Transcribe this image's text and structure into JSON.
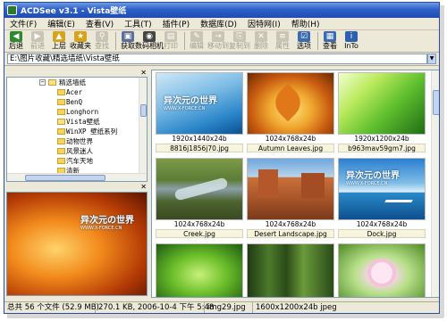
{
  "window": {
    "title": "ACDSee v3.1 - Vista壁纸"
  },
  "menu": [
    "文件(F)",
    "编辑(E)",
    "查看(V)",
    "工具(T)",
    "插件(P)",
    "数据库(D)",
    "因特网(I)",
    "帮助(H)"
  ],
  "toolbar": {
    "buttons": [
      {
        "label": "后退",
        "icon": "back-arrow-icon",
        "color": "#2f8a2f",
        "glyph": "◀",
        "enabled": true
      },
      {
        "label": "前进",
        "icon": "forward-arrow-icon",
        "color": "#2f8a2f",
        "glyph": "▶",
        "enabled": false
      },
      {
        "label": "上层",
        "icon": "up-folder-icon",
        "color": "#d9a21b",
        "glyph": "▲",
        "enabled": true
      },
      {
        "label": "收藏夹",
        "icon": "favorites-icon",
        "color": "#d9a21b",
        "glyph": "★",
        "enabled": true
      },
      {
        "label": "查找",
        "icon": "search-icon",
        "color": "#6b7fa8",
        "glyph": "⚲",
        "enabled": false
      },
      {
        "label": "获取",
        "icon": "acquire-icon",
        "color": "#5a6f99",
        "glyph": "▣",
        "enabled": true
      },
      {
        "label": "数码相机",
        "icon": "camera-icon",
        "color": "#444444",
        "glyph": "◉",
        "enabled": true
      },
      {
        "label": "打印",
        "icon": "printer-icon",
        "color": "#777777",
        "glyph": "▤",
        "enabled": false
      },
      {
        "label": "编辑",
        "icon": "edit-icon",
        "color": "#777777",
        "glyph": "✎",
        "enabled": false
      },
      {
        "label": "移动到",
        "icon": "move-to-icon",
        "color": "#777777",
        "glyph": "→",
        "enabled": false
      },
      {
        "label": "复制到",
        "icon": "copy-to-icon",
        "color": "#777777",
        "glyph": "⎘",
        "enabled": false
      },
      {
        "label": "删除",
        "icon": "delete-icon",
        "color": "#777777",
        "glyph": "✕",
        "enabled": false
      },
      {
        "label": "属性",
        "icon": "properties-icon",
        "color": "#777777",
        "glyph": "≡",
        "enabled": false
      },
      {
        "label": "选项",
        "icon": "options-icon",
        "color": "#3a6ab0",
        "glyph": "☑",
        "enabled": true
      },
      {
        "label": "查看",
        "icon": "view-icon",
        "color": "#3a6ab0",
        "glyph": "▦",
        "enabled": true
      },
      {
        "label": "InTo",
        "icon": "into-icon",
        "color": "#2f5fb0",
        "glyph": "i",
        "enabled": true
      }
    ]
  },
  "address": {
    "path": "E:\\图片收藏\\精选墙纸\\Vista壁纸"
  },
  "tree": {
    "items": [
      {
        "label": "精选墙纸",
        "expander": "−",
        "open": true,
        "indent": 0
      },
      {
        "label": "Acer",
        "expander": "",
        "open": false,
        "indent": 1
      },
      {
        "label": "BenQ",
        "expander": "",
        "open": false,
        "indent": 1
      },
      {
        "label": "Longhorn",
        "expander": "",
        "open": false,
        "indent": 1
      },
      {
        "label": "Vista壁纸",
        "expander": "",
        "open": true,
        "indent": 1
      },
      {
        "label": "WinXP 壁纸系列",
        "expander": "",
        "open": false,
        "indent": 1
      },
      {
        "label": "动物世界",
        "expander": "",
        "open": false,
        "indent": 1
      },
      {
        "label": "风景迷人",
        "expander": "+",
        "open": false,
        "indent": 1
      },
      {
        "label": "汽车天地",
        "expander": "",
        "open": false,
        "indent": 1
      },
      {
        "label": "清新",
        "expander": "",
        "open": false,
        "indent": 1
      }
    ]
  },
  "preview": {
    "logo": "异次元の世界",
    "logo_sub": "WWW.X-FORCE.CN"
  },
  "thumbnails": [
    {
      "dim": "1920x1440x24b",
      "name": "8816j1856j70.jpg",
      "scene": "logo-blue"
    },
    {
      "dim": "1024x768x24b",
      "name": "Autumn Leaves.jpg",
      "scene": "autumn"
    },
    {
      "dim": "1920x1200x24b",
      "name": "b963mav59gm7.jpg",
      "scene": "green"
    },
    {
      "dim": "1024x768x24b",
      "name": "Creek.jpg",
      "scene": "creek"
    },
    {
      "dim": "1024x768x24b",
      "name": "Desert Landscape.jpg",
      "scene": "desert"
    },
    {
      "dim": "1024x768x24b",
      "name": "Dock.jpg",
      "scene": "dock"
    },
    {
      "dim": "",
      "name": "",
      "scene": "leaves"
    },
    {
      "dim": "",
      "name": "",
      "scene": "forest"
    },
    {
      "dim": "",
      "name": "",
      "scene": "flower"
    }
  ],
  "status": {
    "total": "总共 56 个文件 (52.9 MB)",
    "info": "270.1 KB, 2006-10-4 下午 5:48",
    "filename": "img29.jpg",
    "dims": "1600x1200x24b jpeg"
  }
}
